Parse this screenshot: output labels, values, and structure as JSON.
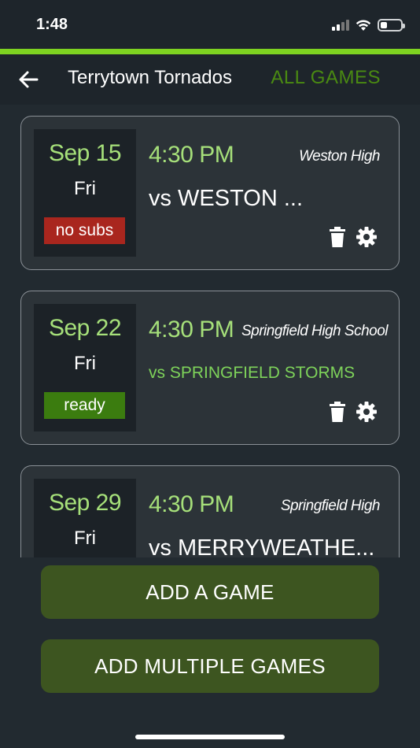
{
  "status_bar": {
    "time": "1:48"
  },
  "header": {
    "title": "Terrytown Tornados",
    "all_games_label": "ALL GAMES"
  },
  "colors": {
    "accent": "#7ed321",
    "date_green": "#a6e07a",
    "badge_red": "#a9261e",
    "badge_green": "#3b7c0f",
    "button": "#3d5520"
  },
  "games": [
    {
      "date": "Sep 15",
      "day": "Fri",
      "status": "no subs",
      "time": "4:30 PM",
      "location": "Weston High",
      "opponent": "vs  WESTON ..."
    },
    {
      "date": "Sep 22",
      "day": "Fri",
      "status": "ready",
      "time": "4:30 PM",
      "location": "Springfield High School",
      "opponent": "vs  SPRINGFIELD STORMS"
    },
    {
      "date": "Sep 29",
      "day": "Fri",
      "status": "",
      "time": "4:30 PM",
      "location": "Springfield High",
      "opponent": "vs  MERRYWEATHE..."
    }
  ],
  "actions": {
    "add_game": "ADD A GAME",
    "add_multiple": "ADD MULTIPLE GAMES"
  },
  "icons": {
    "back": "arrow-left-icon",
    "delete": "trash-icon",
    "settings": "gear-icon"
  }
}
